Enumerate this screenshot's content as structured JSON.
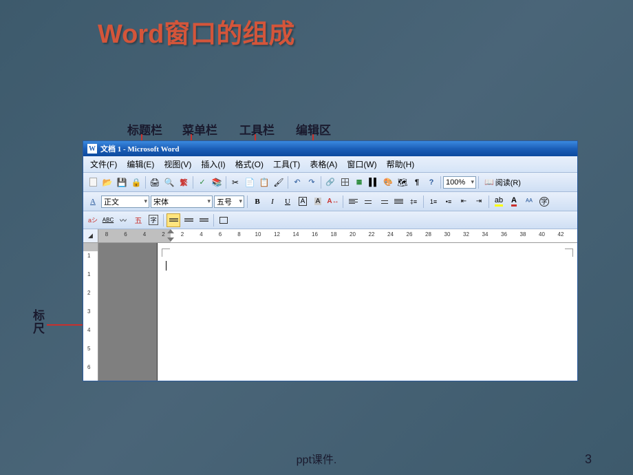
{
  "slide": {
    "title": "Word窗口的组成",
    "footer": "ppt课件.",
    "page_number": "3"
  },
  "annotations": {
    "titlebar": "标题栏",
    "menubar": "菜单栏",
    "toolbar": "工具栏",
    "edit_area": "编辑区",
    "ruler_line1": "标",
    "ruler_line2": "尺"
  },
  "word": {
    "title": "文档 1 - Microsoft Word",
    "menus": {
      "file": "文件(F)",
      "edit": "编辑(E)",
      "view": "视图(V)",
      "insert": "插入(I)",
      "format": "格式(O)",
      "tools": "工具(T)",
      "table": "表格(A)",
      "window": "窗口(W)",
      "help": "帮助(H)"
    },
    "toolbar1": {
      "zoom": "100%",
      "read": "阅读(R)"
    },
    "toolbar2": {
      "style_label": "A",
      "style": "正文",
      "font": "宋体",
      "size": "五号",
      "bold": "B",
      "italic": "I",
      "underline": "U",
      "char_a": "A",
      "char_zi": "字"
    },
    "toolbar3": {
      "ay": "aシ",
      "abc": "ABC",
      "wubi": "五",
      "zi": "字"
    },
    "ruler": {
      "ticks": [
        "8",
        "6",
        "4",
        "2",
        "2",
        "4",
        "6",
        "8",
        "10",
        "12",
        "14",
        "16",
        "18",
        "20",
        "22",
        "24",
        "26",
        "28",
        "30",
        "32",
        "34",
        "36",
        "38",
        "40",
        "42"
      ]
    },
    "vruler": {
      "ticks": [
        "1",
        "1",
        "2",
        "3",
        "4",
        "5",
        "6"
      ]
    }
  }
}
